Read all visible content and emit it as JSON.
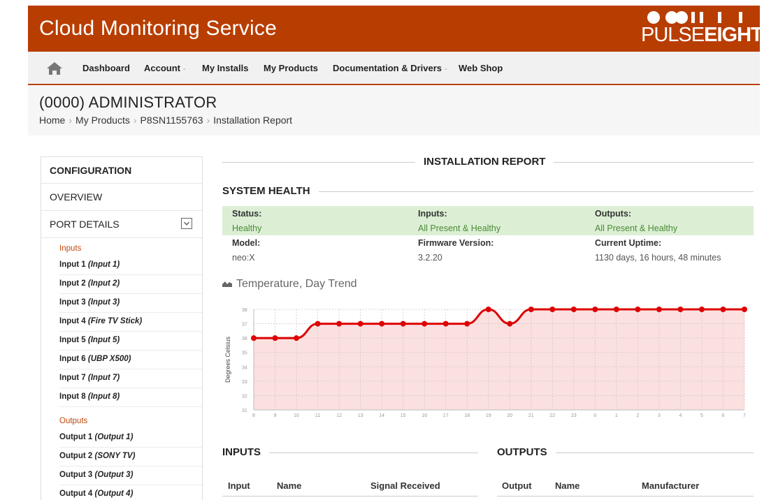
{
  "header": {
    "title": "Cloud Monitoring Service",
    "logo_text_light": "PULSE",
    "logo_text_bold": "EIGHT"
  },
  "nav": {
    "items": [
      {
        "label": "Dashboard",
        "dropdown": false
      },
      {
        "label": "Account",
        "dropdown": true
      },
      {
        "label": "My Installs",
        "dropdown": false
      },
      {
        "label": "My Products",
        "dropdown": false
      },
      {
        "label": "Documentation & Drivers",
        "dropdown": true
      },
      {
        "label": "Web Shop",
        "dropdown": false
      }
    ],
    "caret": "-"
  },
  "page": {
    "title": "(0000)  ADMINISTRATOR",
    "breadcrumb": [
      "Home",
      "My Products",
      "P8SN1155763",
      "Installation Report"
    ],
    "breadcrumb_sep": "›"
  },
  "sidebar": {
    "configuration": "CONFIGURATION",
    "overview": "OVERVIEW",
    "port_details": "PORT DETAILS",
    "inputs_label": "Inputs",
    "inputs": [
      {
        "name": "Input 1",
        "alias": "(Input 1)"
      },
      {
        "name": "Input 2",
        "alias": "(Input 2)"
      },
      {
        "name": "Input 3",
        "alias": "(Input 3)"
      },
      {
        "name": "Input 4",
        "alias": "(Fire TV Stick)"
      },
      {
        "name": "Input 5",
        "alias": "(Input 5)"
      },
      {
        "name": "Input 6",
        "alias": "(UBP X500)"
      },
      {
        "name": "Input 7",
        "alias": "(Input 7)"
      },
      {
        "name": "Input 8",
        "alias": "(Input 8)"
      }
    ],
    "outputs_label": "Outputs",
    "outputs": [
      {
        "name": "Output 1",
        "alias": "(Output 1)"
      },
      {
        "name": "Output 2",
        "alias": "(SONY TV)"
      },
      {
        "name": "Output 3",
        "alias": "(Output 3)"
      },
      {
        "name": "Output 4",
        "alias": "(Output 4)"
      }
    ]
  },
  "report": {
    "heading": "INSTALLATION REPORT"
  },
  "system_health": {
    "heading": "SYSTEM HEALTH",
    "status_label": "Status:",
    "status_value": "Healthy",
    "inputs_label": "Inputs:",
    "inputs_value": "All Present & Healthy",
    "outputs_label": "Outputs:",
    "outputs_value": "All Present & Healthy",
    "model_label": "Model:",
    "model_value": "neo:X",
    "firmware_label": "Firmware Version:",
    "firmware_value": "3.2.20",
    "uptime_label": "Current Uptime:",
    "uptime_value": "1130 days, 16 hours, 48 minutes",
    "status_color": "#dcefd5"
  },
  "temperature": {
    "title": "Temperature, Day Trend",
    "chart_data": {
      "type": "area",
      "title": "",
      "ylabel": "Degrees Celsius",
      "xlabel": "",
      "categories": [
        "8",
        "9",
        "10",
        "11",
        "12",
        "13",
        "14",
        "15",
        "16",
        "17",
        "18",
        "19",
        "20",
        "21",
        "22",
        "23",
        "0",
        "1",
        "2",
        "3",
        "4",
        "5",
        "6",
        "7"
      ],
      "values": [
        36,
        36,
        36,
        37,
        37,
        37,
        37,
        37,
        37,
        37,
        37,
        38,
        37,
        38,
        38,
        38,
        38,
        38,
        38,
        38,
        38,
        38,
        38,
        38
      ],
      "yticks": [
        31,
        32,
        33,
        34,
        35,
        36,
        37,
        38
      ],
      "ylim": [
        31,
        38
      ],
      "grid": true,
      "line_color": "#dd0000",
      "fill_color": "#fbe0e0"
    }
  },
  "inputs_table": {
    "heading": "INPUTS",
    "columns": [
      "Input",
      "Name",
      "Signal Received"
    ]
  },
  "outputs_table": {
    "heading": "OUTPUTS",
    "columns": [
      "Output",
      "Name",
      "Manufacturer"
    ]
  },
  "colors": {
    "brand": "#b83d00",
    "accent_text": "#c2470a"
  }
}
